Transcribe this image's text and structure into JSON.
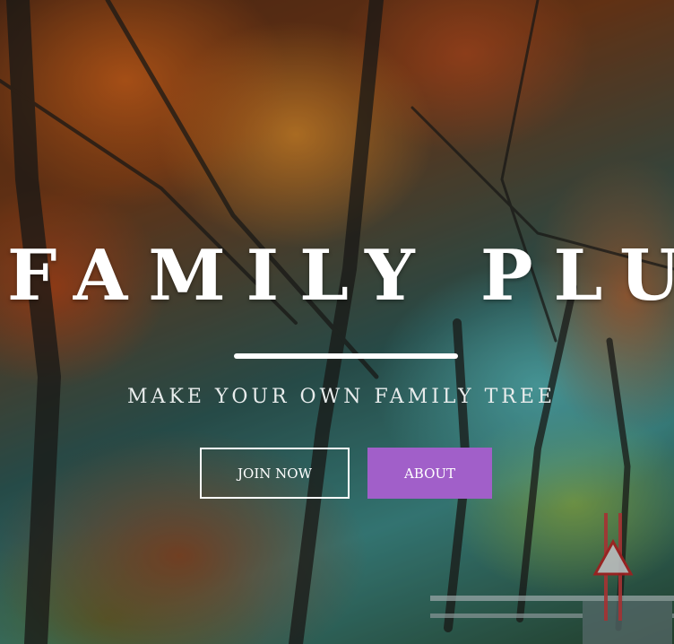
{
  "hero": {
    "title": "FAMILY PLUS",
    "subtitle": "MAKE YOUR OWN FAMILY TREE",
    "buttons": {
      "join_label": "JOIN NOW",
      "about_label": "ABOUT"
    }
  },
  "colors": {
    "accent": "#a15fc9",
    "text": "#ffffff"
  },
  "background": {
    "description_icon": "autumn-forest-image"
  }
}
